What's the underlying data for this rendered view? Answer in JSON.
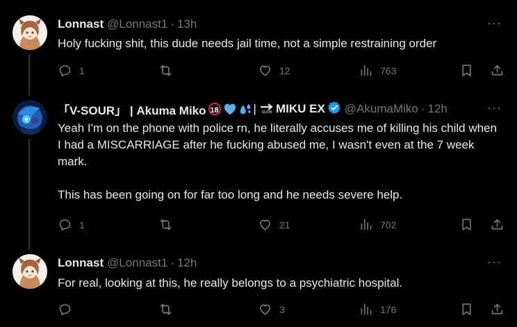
{
  "tweets": [
    {
      "name": "Lonnast",
      "handle": "@Lonnast1",
      "separator": "·",
      "time": "13h",
      "more": "···",
      "text": "Holy fucking shit, this dude needs jail time, not a simple restraining order",
      "replies": "1",
      "retweets": "",
      "likes": "12",
      "views": "763"
    },
    {
      "name": "「V-SOUR」 | Akuma Miko",
      "name_suffix": "MIKU EX",
      "soon_label": "SOON",
      "handle": "@AkumaMiko",
      "separator": "·",
      "time": "12h",
      "more": "···",
      "text": "Yeah I'm on the phone with police rn, he literally accuses me of killing his child when I had a MISCARRIAGE after he fucking abused me, I wasn't even at the 7 week mark.\n\nThis has been going on for far too long and he needs severe help.",
      "replies": "1",
      "retweets": "",
      "likes": "21",
      "views": "702"
    },
    {
      "name": "Lonnast",
      "handle": "@Lonnast1",
      "separator": "·",
      "time": "12h",
      "more": "···",
      "text": "For real, looking at this, he really belongs to a psychiatric hospital.",
      "replies": "",
      "retweets": "",
      "likes": "3",
      "views": "176"
    }
  ],
  "icons": {
    "reply": "reply-icon",
    "retweet": "retweet-icon",
    "like": "like-icon",
    "views": "views-icon",
    "bookmark": "bookmark-icon",
    "share": "share-icon"
  },
  "colors": {
    "background": "#000000",
    "text": "#e7e9ea",
    "muted": "#71767b",
    "verified": "#1d9bf0",
    "thread_line": "#333639"
  }
}
